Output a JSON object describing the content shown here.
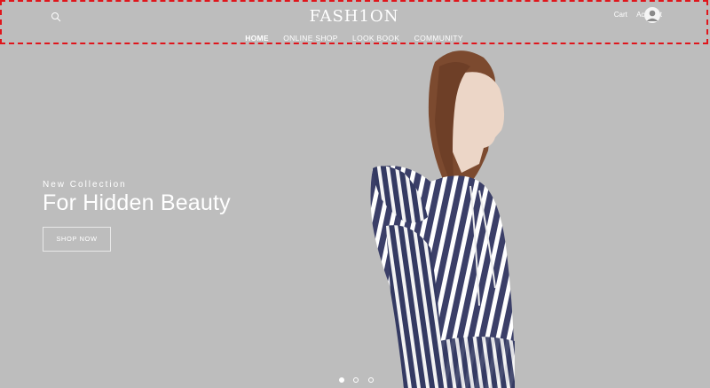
{
  "brand": "FASH1ON",
  "nav": {
    "items": [
      {
        "label": "HOME",
        "active": true
      },
      {
        "label": "ONLINE SHOP",
        "active": false
      },
      {
        "label": "LOOK BOOK",
        "active": false
      },
      {
        "label": "COMMUNITY",
        "active": false
      }
    ]
  },
  "header": {
    "cart_label": "Cart",
    "account_label": "Account",
    "search_icon": "search-icon",
    "avatar_icon": "user-icon"
  },
  "hero": {
    "subtitle": "New Collection",
    "title": "For Hidden Beauty",
    "cta_label": "SHOP NOW"
  },
  "carousel": {
    "slides": 3,
    "active_index": 0
  },
  "colors": {
    "background": "#bdbdbd",
    "header_outline": "#e0151b",
    "text": "#ffffff"
  }
}
